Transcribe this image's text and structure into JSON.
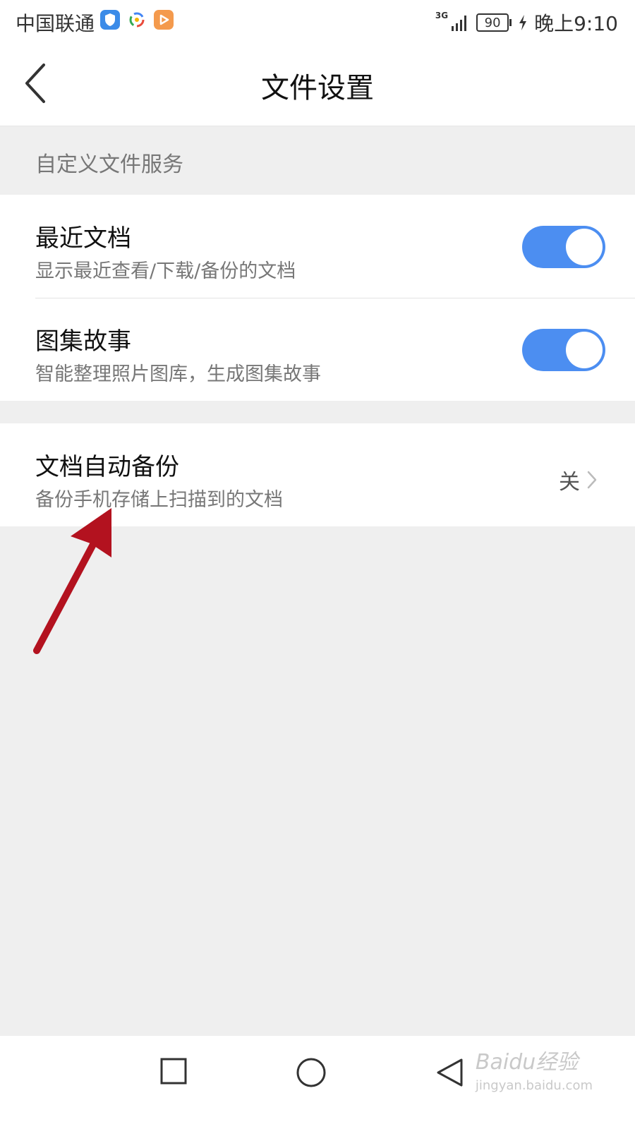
{
  "status_bar": {
    "carrier": "中国联通",
    "network": "3G",
    "battery": "90",
    "time": "晚上9:10"
  },
  "header": {
    "title": "文件设置"
  },
  "section": {
    "label": "自定义文件服务"
  },
  "settings": {
    "recent_docs": {
      "title": "最近文档",
      "subtitle": "显示最近查看/下载/备份的文档",
      "enabled": true
    },
    "album_story": {
      "title": "图集故事",
      "subtitle": "智能整理照片图库，生成图集故事",
      "enabled": true
    },
    "auto_backup": {
      "title": "文档自动备份",
      "subtitle": "备份手机存储上扫描到的文档",
      "value": "关"
    }
  },
  "watermark": {
    "brand": "Baidu经验",
    "url": "jingyan.baidu.com"
  },
  "colors": {
    "accent": "#4c8ef1",
    "annotation_arrow": "#b3121f",
    "background": "#efefef"
  }
}
